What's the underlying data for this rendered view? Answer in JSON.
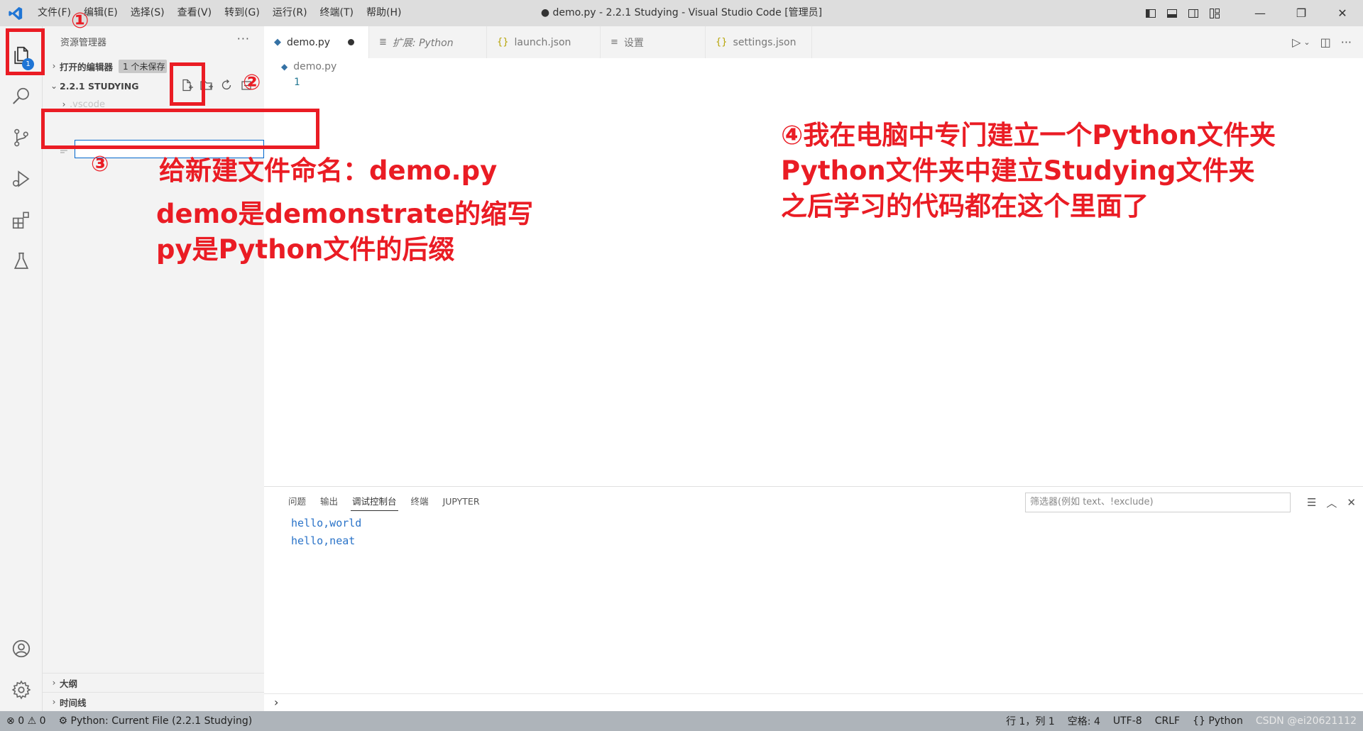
{
  "titlebar": {
    "menu": [
      "文件(F)",
      "编辑(E)",
      "选择(S)",
      "查看(V)",
      "转到(G)",
      "运行(R)",
      "终端(T)",
      "帮助(H)"
    ],
    "title": "● demo.py - 2.2.1 Studying - Visual Studio Code [管理员]",
    "minimize": "—",
    "restore": "❐",
    "close": "✕"
  },
  "activitybar": {
    "explorer_badge": "1"
  },
  "sidebar": {
    "header": "资源管理器",
    "more": "···",
    "open_editors": "打开的编辑器",
    "unsaved": "1 个未保存",
    "folder": "2.2.1 STUDYING",
    "tree_item": ".vscode",
    "rename_value": "",
    "outline": "大纲",
    "timeline": "时间线"
  },
  "tabs": [
    {
      "label": "demo.py",
      "icon": "python-icon"
    },
    {
      "label": "扩展: Python",
      "icon": "extensions-icon"
    },
    {
      "label": "launch.json",
      "icon": "json-icon"
    },
    {
      "label": "设置",
      "icon": "settings-file-icon"
    },
    {
      "label": "settings.json",
      "icon": "json-icon"
    }
  ],
  "editor": {
    "breadcrumb": "demo.py",
    "line1": "1"
  },
  "panel": {
    "tabs": [
      "问题",
      "输出",
      "调试控制台",
      "终端",
      "JUPYTER"
    ],
    "filter_placeholder": "筛选器(例如 text、!exclude)",
    "lines": [
      "hello,world",
      "hello,neat"
    ],
    "prompt": "›"
  },
  "statusbar": {
    "errors": "0",
    "warnings": "0",
    "run": "Python: Current File (2.2.1 Studying)",
    "position": "行 1，列 1",
    "spaces": "空格: 4",
    "encoding": "UTF-8",
    "eol": "CRLF",
    "language": "Python",
    "watermark": "CSDN @ei20621112"
  },
  "annotations": {
    "n1": "①",
    "n2": "②",
    "n3": "③",
    "n4_line1": "④我在电脑中专门建立一个Python文件夹",
    "n4_line2": "Python文件夹中建立Studying文件夹",
    "n4_line3": "之后学习的代码都在这个里面了",
    "name_text": "给新建文件命名：demo.py",
    "demo_text": "demo是demonstrate的缩写",
    "py_text": "py是Python文件的后缀"
  },
  "colors": {
    "annotation": "#ea1c24",
    "accent": "#1f75d5",
    "console_text": "#2a73c8"
  }
}
